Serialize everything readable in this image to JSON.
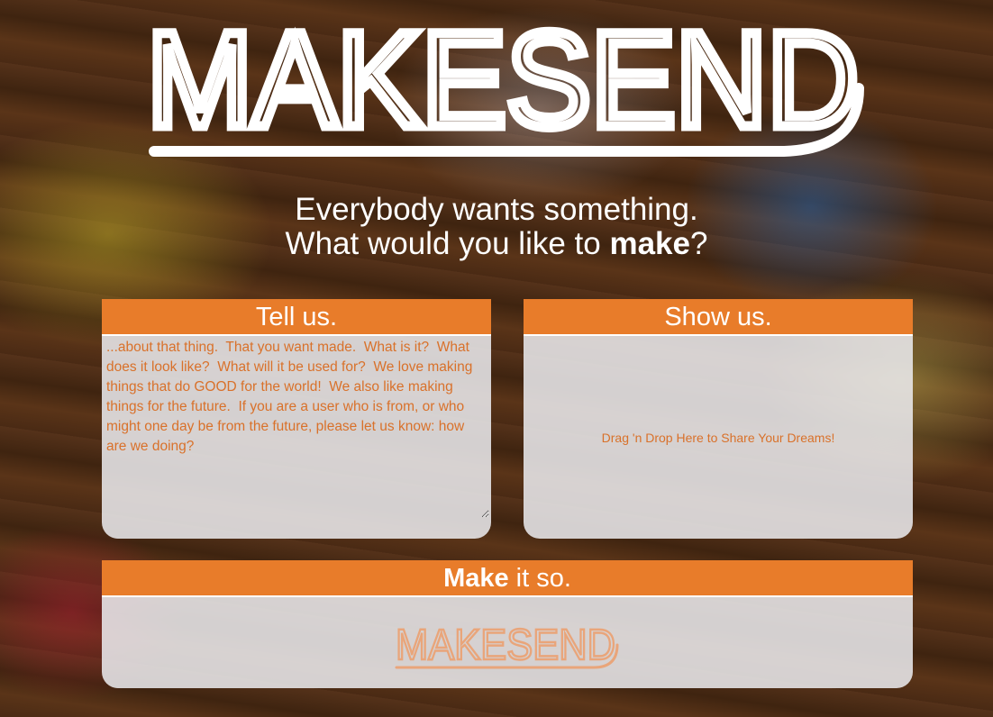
{
  "brand": {
    "name": "MAKESEND",
    "logo_color": "#ffffff",
    "mini_logo_color": "#e9a57a"
  },
  "tagline": {
    "line1": "Everybody wants something.",
    "line2_prefix": "What would you like to ",
    "line2_bold": "make",
    "line2_suffix": "?"
  },
  "tell_panel": {
    "title": "Tell us.",
    "textarea_value": "...about that thing.  That you want made.  What is it?  What does it look like?  What will it be used for?  We love making things that do GOOD for the world!  We also like making things for the future.  If you are a user who is from, or who might one day be from the future, please let us know: how are we doing?"
  },
  "show_panel": {
    "title": "Show us.",
    "drop_text": "Drag 'n Drop Here to Share Your Dreams!"
  },
  "make_panel": {
    "title_bold": "Make",
    "title_rest": " it so."
  },
  "colors": {
    "accent": "#e87c2a",
    "text_accent": "#d9712a",
    "panel_bg": "#ececf0"
  }
}
